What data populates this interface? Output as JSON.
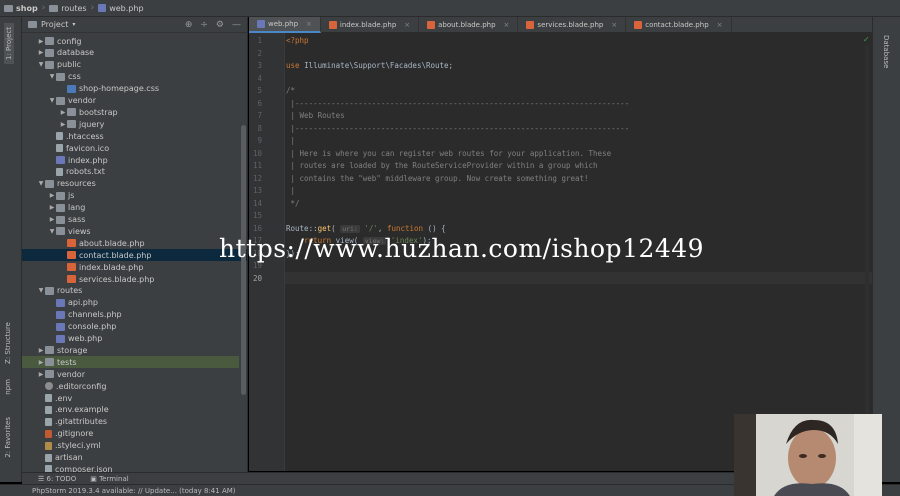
{
  "breadcrumb": [
    {
      "label": "shop",
      "bold": true
    },
    {
      "label": "routes",
      "bold": false
    },
    {
      "label": "web.php",
      "bold": false
    }
  ],
  "left_strip": {
    "project_tab": "1: Project",
    "structure_tab": "Z: Structure",
    "npm_tab": "npm",
    "favorites_tab": "2: Favorites"
  },
  "right_strip": {
    "database_tab": "Database"
  },
  "project_panel": {
    "title": "Project",
    "tree": [
      {
        "label": "config",
        "icon": "folder",
        "depth": 1,
        "arrow": "collapsed"
      },
      {
        "label": "database",
        "icon": "folder",
        "depth": 1,
        "arrow": "collapsed"
      },
      {
        "label": "public",
        "icon": "folder",
        "depth": 1,
        "arrow": "expanded"
      },
      {
        "label": "css",
        "icon": "folder",
        "depth": 2,
        "arrow": "expanded"
      },
      {
        "label": "shop-homepage.css",
        "icon": "css",
        "depth": 3,
        "arrow": ""
      },
      {
        "label": "vendor",
        "icon": "folder",
        "depth": 2,
        "arrow": "expanded"
      },
      {
        "label": "bootstrap",
        "icon": "folder",
        "depth": 3,
        "arrow": "collapsed"
      },
      {
        "label": "jquery",
        "icon": "folder",
        "depth": 3,
        "arrow": "collapsed"
      },
      {
        "label": ".htaccess",
        "icon": "file",
        "depth": 2,
        "arrow": ""
      },
      {
        "label": "favicon.ico",
        "icon": "file",
        "depth": 2,
        "arrow": ""
      },
      {
        "label": "index.php",
        "icon": "php",
        "depth": 2,
        "arrow": ""
      },
      {
        "label": "robots.txt",
        "icon": "file",
        "depth": 2,
        "arrow": ""
      },
      {
        "label": "resources",
        "icon": "folder",
        "depth": 1,
        "arrow": "expanded"
      },
      {
        "label": "js",
        "icon": "folder",
        "depth": 2,
        "arrow": "collapsed"
      },
      {
        "label": "lang",
        "icon": "folder",
        "depth": 2,
        "arrow": "collapsed"
      },
      {
        "label": "sass",
        "icon": "folder",
        "depth": 2,
        "arrow": "collapsed"
      },
      {
        "label": "views",
        "icon": "folder",
        "depth": 2,
        "arrow": "expanded"
      },
      {
        "label": "about.blade.php",
        "icon": "blade",
        "depth": 3,
        "arrow": ""
      },
      {
        "label": "contact.blade.php",
        "icon": "blade",
        "depth": 3,
        "arrow": "",
        "selected": true
      },
      {
        "label": "index.blade.php",
        "icon": "blade",
        "depth": 3,
        "arrow": ""
      },
      {
        "label": "services.blade.php",
        "icon": "blade",
        "depth": 3,
        "arrow": ""
      },
      {
        "label": "routes",
        "icon": "folder",
        "depth": 1,
        "arrow": "expanded"
      },
      {
        "label": "api.php",
        "icon": "php",
        "depth": 2,
        "arrow": ""
      },
      {
        "label": "channels.php",
        "icon": "php",
        "depth": 2,
        "arrow": ""
      },
      {
        "label": "console.php",
        "icon": "php",
        "depth": 2,
        "arrow": ""
      },
      {
        "label": "web.php",
        "icon": "php",
        "depth": 2,
        "arrow": ""
      },
      {
        "label": "storage",
        "icon": "folder",
        "depth": 1,
        "arrow": "collapsed"
      },
      {
        "label": "tests",
        "icon": "folder",
        "depth": 1,
        "arrow": "collapsed",
        "highlighted": true
      },
      {
        "label": "vendor",
        "icon": "folder",
        "depth": 1,
        "arrow": "collapsed"
      },
      {
        "label": ".editorconfig",
        "icon": "gear",
        "depth": 1,
        "arrow": ""
      },
      {
        "label": ".env",
        "icon": "file",
        "depth": 1,
        "arrow": ""
      },
      {
        "label": ".env.example",
        "icon": "file",
        "depth": 1,
        "arrow": ""
      },
      {
        "label": ".gitattributes",
        "icon": "file",
        "depth": 1,
        "arrow": ""
      },
      {
        "label": ".gitignore",
        "icon": "git",
        "depth": 1,
        "arrow": ""
      },
      {
        "label": ".styleci.yml",
        "icon": "yml",
        "depth": 1,
        "arrow": ""
      },
      {
        "label": "artisan",
        "icon": "file",
        "depth": 1,
        "arrow": ""
      },
      {
        "label": "composer.json",
        "icon": "file",
        "depth": 1,
        "arrow": ""
      }
    ]
  },
  "editor_tabs": [
    {
      "label": "web.php",
      "icon": "php",
      "active": true
    },
    {
      "label": "index.blade.php",
      "icon": "blade",
      "active": false
    },
    {
      "label": "about.blade.php",
      "icon": "blade",
      "active": false
    },
    {
      "label": "services.blade.php",
      "icon": "blade",
      "active": false
    },
    {
      "label": "contact.blade.php",
      "icon": "blade",
      "active": false
    }
  ],
  "code": {
    "current_line": 20,
    "lines": [
      {
        "n": "1",
        "tokens": [
          {
            "t": "<?php",
            "c": "kw"
          }
        ]
      },
      {
        "n": "2",
        "tokens": []
      },
      {
        "n": "3",
        "tokens": [
          {
            "t": "use ",
            "c": "kw"
          },
          {
            "t": "Illuminate\\Support\\Facades\\Route;",
            "c": ""
          }
        ]
      },
      {
        "n": "4",
        "tokens": []
      },
      {
        "n": "5",
        "tokens": [
          {
            "t": "/*",
            "c": "cm"
          }
        ]
      },
      {
        "n": "6",
        "tokens": [
          {
            "t": " |--------------------------------------------------------------------------",
            "c": "cm"
          }
        ]
      },
      {
        "n": "7",
        "tokens": [
          {
            "t": " | Web Routes",
            "c": "cm"
          }
        ]
      },
      {
        "n": "8",
        "tokens": [
          {
            "t": " |--------------------------------------------------------------------------",
            "c": "cm"
          }
        ]
      },
      {
        "n": "9",
        "tokens": [
          {
            "t": " |",
            "c": "cm"
          }
        ]
      },
      {
        "n": "10",
        "tokens": [
          {
            "t": " | Here is where you can register web routes for your application. These",
            "c": "cm"
          }
        ]
      },
      {
        "n": "11",
        "tokens": [
          {
            "t": " | routes are loaded by the RouteServiceProvider within a group which",
            "c": "cm"
          }
        ]
      },
      {
        "n": "12",
        "tokens": [
          {
            "t": " | contains the \"web\" middleware group. Now create something great!",
            "c": "cm"
          }
        ]
      },
      {
        "n": "13",
        "tokens": [
          {
            "t": " |",
            "c": "cm"
          }
        ]
      },
      {
        "n": "14",
        "tokens": [
          {
            "t": " */",
            "c": "cm"
          }
        ]
      },
      {
        "n": "15",
        "tokens": []
      },
      {
        "n": "16",
        "tokens": [
          {
            "t": "Route::",
            "c": ""
          },
          {
            "t": "get",
            "c": "fn"
          },
          {
            "t": "( ",
            "c": ""
          },
          {
            "t": "uri:",
            "c": "hint"
          },
          {
            "t": " ",
            "c": ""
          },
          {
            "t": "'/'",
            "c": "str"
          },
          {
            "t": ", ",
            "c": ""
          },
          {
            "t": "function",
            "c": "kw"
          },
          {
            "t": " () {",
            "c": ""
          }
        ]
      },
      {
        "n": "17",
        "tokens": [
          {
            "t": "    ",
            "c": ""
          },
          {
            "t": "return",
            "c": "kw"
          },
          {
            "t": " view( ",
            "c": ""
          },
          {
            "t": "view:",
            "c": "hint"
          },
          {
            "t": " ",
            "c": ""
          },
          {
            "t": "'index'",
            "c": "str"
          },
          {
            "t": ");",
            "c": ""
          }
        ]
      },
      {
        "n": "18",
        "tokens": [
          {
            "t": "});",
            "c": ""
          }
        ]
      },
      {
        "n": "19",
        "tokens": []
      },
      {
        "n": "20",
        "tokens": []
      }
    ]
  },
  "bottom_tools": {
    "todo": "6: TODO",
    "terminal": "Terminal"
  },
  "status_bar": {
    "text": "PhpStorm 2019.3.4 available: // Update... (today 8:41 AM)"
  },
  "watermark": "https://www.huzhan.com/ishop12449",
  "colors": {
    "accent": "#4a88c7",
    "selection": "#0d293e",
    "background": "#2b2b2b"
  }
}
